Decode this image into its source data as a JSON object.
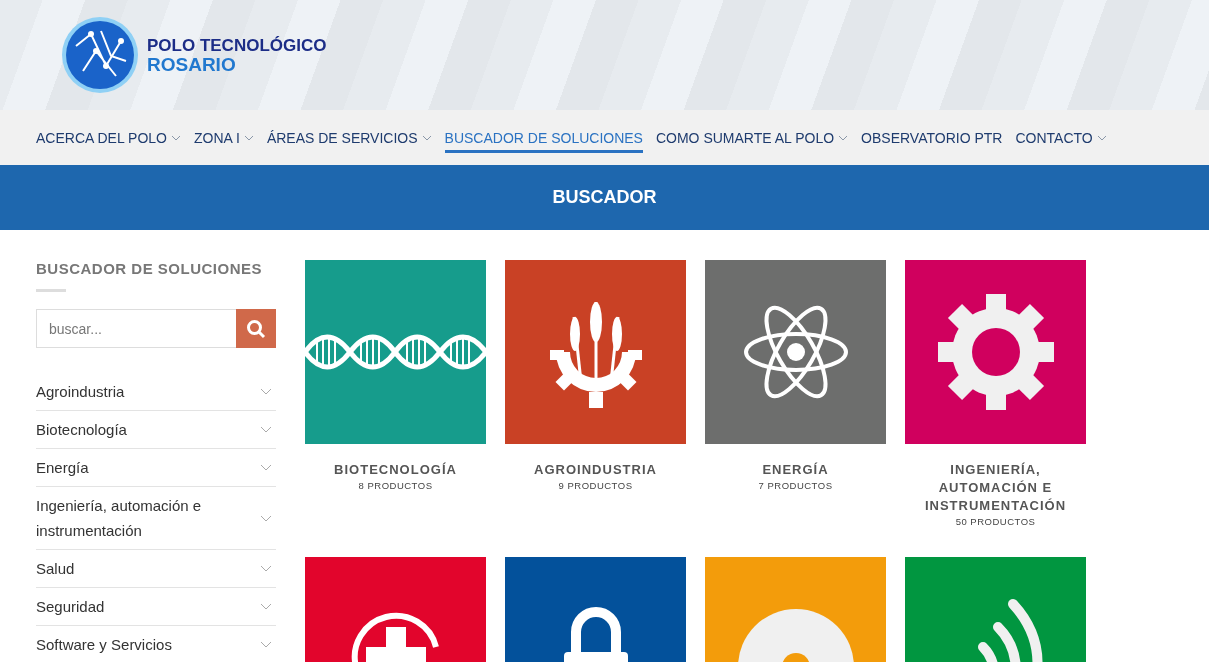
{
  "logo": {
    "line1": "POLO TECNOLÓGICO",
    "line2": "ROSARIO"
  },
  "nav": [
    {
      "label": "ACERCA DEL POLO",
      "dropdown": true,
      "selected": false
    },
    {
      "label": "ZONA I",
      "dropdown": true,
      "selected": false
    },
    {
      "label": "ÁREAS DE SERVICIOS",
      "dropdown": true,
      "selected": false
    },
    {
      "label": "BUSCADOR DE SOLUCIONES",
      "dropdown": false,
      "selected": true
    },
    {
      "label": "COMO SUMARTE AL POLO",
      "dropdown": true,
      "selected": false
    },
    {
      "label": "OBSERVATORIO PTR",
      "dropdown": false,
      "selected": false
    },
    {
      "label": "CONTACTO",
      "dropdown": true,
      "selected": false
    }
  ],
  "banner": {
    "title": "BUSCADOR"
  },
  "sidebar": {
    "title": "BUSCADOR DE SOLUCIONES",
    "search": {
      "placeholder": "buscar..."
    },
    "items": [
      {
        "label": "Agroindustria",
        "expanded": false
      },
      {
        "label": "Biotecnología",
        "expanded": false
      },
      {
        "label": "Energía",
        "expanded": false
      },
      {
        "label": "Ingeniería, automación e instrumentación",
        "expanded": false
      },
      {
        "label": "Salud",
        "expanded": false
      },
      {
        "label": "Seguridad",
        "expanded": false
      },
      {
        "label": "Software y Servicios",
        "expanded": false
      }
    ]
  },
  "categories": [
    {
      "kind": "dna",
      "color": "#169c8c",
      "title": "BIOTECNOLOGÍA",
      "count": "8 PRODUCTOS"
    },
    {
      "kind": "wheat",
      "color": "#c94125",
      "title": "AGROINDUSTRIA",
      "count": "9 PRODUCTOS"
    },
    {
      "kind": "atom",
      "color": "#6d6e6d",
      "title": "ENERGÍA",
      "count": "7 PRODUCTOS"
    },
    {
      "kind": "gear",
      "color": "#d0005e",
      "title": "INGENIERÍA, AUTOMACIÓN E INSTRUMENTACIÓN",
      "count": "50 PRODUCTOS"
    },
    {
      "kind": "health",
      "color": "#e2052c"
    },
    {
      "kind": "lock",
      "color": "#03519b"
    },
    {
      "kind": "disc",
      "color": "#f39c0b"
    },
    {
      "kind": "signal",
      "color": "#019640"
    }
  ]
}
